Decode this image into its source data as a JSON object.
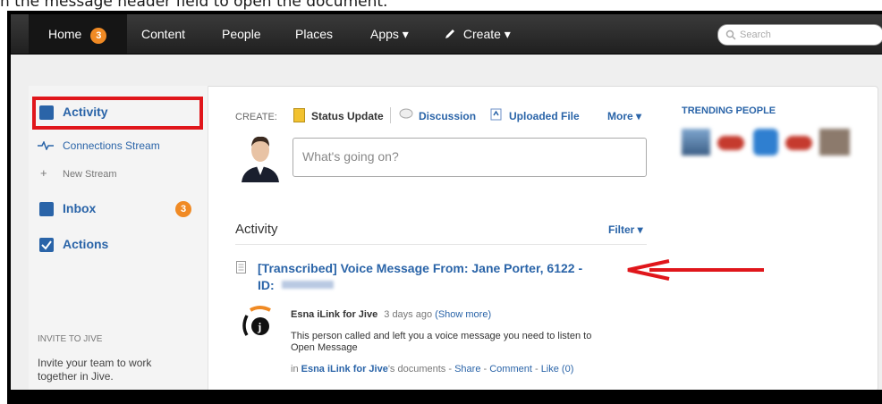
{
  "caption": "n the message header field to open the document.",
  "nav": {
    "home": "Home",
    "home_badge": "3",
    "content": "Content",
    "people": "People",
    "places": "Places",
    "apps": "Apps ▾",
    "create": "Create ▾",
    "search_placeholder": "Search"
  },
  "sidebar": {
    "activity": "Activity",
    "connections_stream": "Connections Stream",
    "new_stream": "New Stream",
    "inbox": "Inbox",
    "inbox_badge": "3",
    "actions": "Actions",
    "invite_heading": "INVITE TO JIVE",
    "invite_text_1": "Invite your team to work",
    "invite_text_2": "together in Jive."
  },
  "create_bar": {
    "label": "CREATE:",
    "status_update": "Status Update",
    "discussion": "Discussion",
    "uploaded_file": "Uploaded File",
    "more": "More ▾"
  },
  "status_input": {
    "placeholder": "What's going on?"
  },
  "activity": {
    "heading": "Activity",
    "filter": "Filter ▾",
    "item_title_1": "[Transcribed] Voice Message From: Jane Porter, 6122 -",
    "item_title_2": "ID:",
    "author": "Esna iLink for Jive",
    "time": "3 days ago",
    "show_more": "(Show more)",
    "message_1": "This person called and left you a voice message you need to listen to",
    "message_2": "Open Message",
    "footer_prefix": "in",
    "footer_author": "Esna iLink for Jive",
    "footer_docs": "'s documents",
    "sep": " - ",
    "share": "Share",
    "comment": "Comment",
    "like": "Like (0)"
  },
  "trending": {
    "heading": "TRENDING PEOPLE"
  },
  "colors": {
    "accent": "#2a64a8",
    "highlight": "#e0161b",
    "badge": "#f08a24"
  }
}
